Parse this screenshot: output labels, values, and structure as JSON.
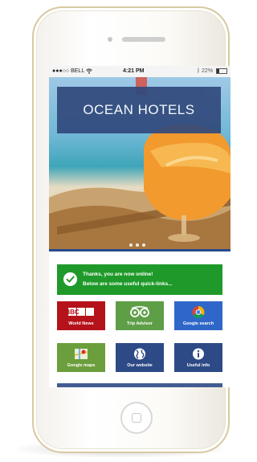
{
  "status_bar": {
    "carrier": "●●●○○ BELL",
    "time": "4:21 PM",
    "battery_text": "22%",
    "wifi_icon": "wifi-icon",
    "bluetooth_icon": "bluetooth-icon"
  },
  "hero": {
    "title": "OCEAN HOTELS",
    "carousel_pages": 3,
    "active_page": 1
  },
  "banner": {
    "line1": "Thanks, you are now online!",
    "line2": "Below are some useful quick-links...",
    "icon": "checkmark-icon"
  },
  "quick_links": [
    {
      "label": "World News",
      "icon": "bbc-logo-icon",
      "logo_text": "BBC",
      "color": "#b5121b"
    },
    {
      "label": "Trip Advisor",
      "icon": "owl-icon",
      "color": "#5e9e47"
    },
    {
      "label": "Google search",
      "icon": "chrome-icon",
      "color": "#2f67c9"
    },
    {
      "label": "Google maps",
      "icon": "map-icon",
      "color": "#6b9e3c"
    },
    {
      "label": "Our website",
      "icon": "globe-icon",
      "color": "#2d4a86"
    },
    {
      "label": "Useful info",
      "icon": "info-icon",
      "color": "#2d4a86"
    }
  ],
  "colors": {
    "brand_navy": "#31497c",
    "success_green": "#1f9a2a",
    "phone_trim": "#d9c9a3"
  }
}
